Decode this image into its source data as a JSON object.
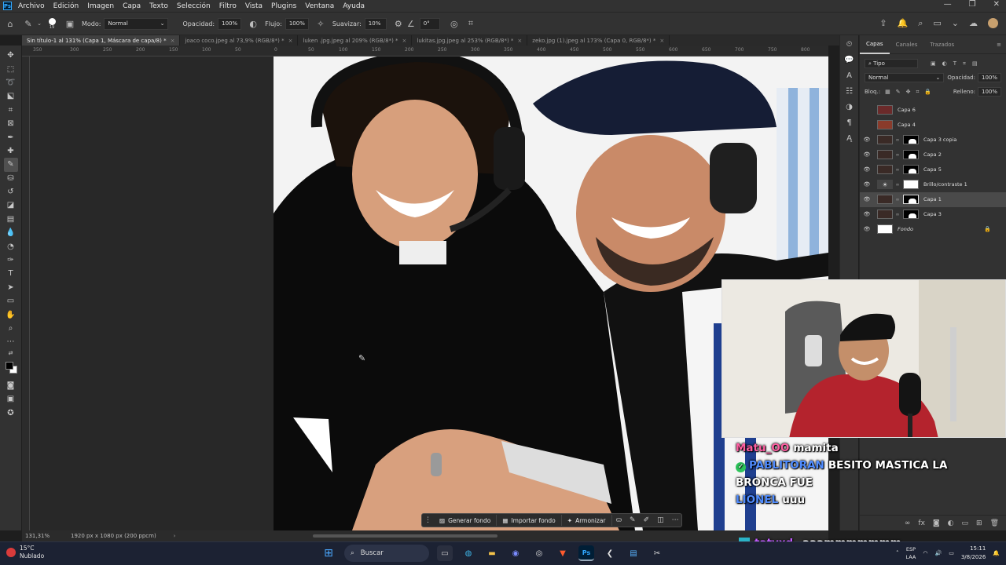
{
  "menu": {
    "items": [
      "Archivo",
      "Edición",
      "Imagen",
      "Capa",
      "Texto",
      "Selección",
      "Filtro",
      "Vista",
      "Plugins",
      "Ventana",
      "Ayuda"
    ],
    "logo": "Ps"
  },
  "options": {
    "brush_size": "19",
    "mode_label": "Modo:",
    "mode_value": "Normal",
    "opacity_label": "Opacidad:",
    "opacity_value": "100%",
    "flow_label": "Flujo:",
    "flow_value": "100%",
    "smooth_label": "Suavizar:",
    "smooth_value": "10%",
    "angle_value": "0°"
  },
  "tabs": [
    {
      "label": "Sin título-1 al 131% (Capa 1, Máscara de capa/8) *",
      "active": true
    },
    {
      "label": "joaco coco.jpeg al 73,9% (RGB/8*) *",
      "active": false
    },
    {
      "label": "luken .jpg.jpeg al 209% (RGB/8*) *",
      "active": false
    },
    {
      "label": "lukitas.jpg.jpeg al 253% (RGB/8*) *",
      "active": false
    },
    {
      "label": "zeko.jpg (1).jpeg al 173% (Capa 0, RGB/8*) *",
      "active": false
    }
  ],
  "ruler_ticks": [
    "350",
    "300",
    "250",
    "200",
    "150",
    "100",
    "50",
    "0",
    "50",
    "100",
    "150",
    "200",
    "250",
    "300",
    "350",
    "400",
    "450",
    "500",
    "550",
    "600",
    "650",
    "700",
    "750",
    "800",
    "850",
    "900",
    "950",
    "1000"
  ],
  "status": {
    "zoom": "131,31%",
    "doc_info": "1920 px x 1080 px (200 ppcm)"
  },
  "contextual_bar": {
    "generate_bg": "Generar fondo",
    "import_bg": "Importar fondo",
    "harmonize": "Armonizar"
  },
  "layers_panel": {
    "tabs": [
      "Capas",
      "Canales",
      "Trazados"
    ],
    "filter_label": "Tipo",
    "blend_mode": "Normal",
    "opacity_label": "Opacidad:",
    "opacity_value": "100%",
    "lock_label": "Bloq.:",
    "fill_label": "Relleno:",
    "fill_value": "100%",
    "layers": [
      {
        "name": "Capa 6",
        "visible": false,
        "mask": false,
        "selected": false,
        "italic": false
      },
      {
        "name": "Capa 4",
        "visible": false,
        "mask": false,
        "selected": false,
        "italic": false
      },
      {
        "name": "Capa 3 copia",
        "visible": true,
        "mask": true,
        "selected": false,
        "italic": false
      },
      {
        "name": "Capa 2",
        "visible": true,
        "mask": true,
        "selected": false,
        "italic": false
      },
      {
        "name": "Capa 5",
        "visible": true,
        "mask": true,
        "selected": false,
        "italic": false
      },
      {
        "name": "Brillo/contraste 1",
        "visible": true,
        "mask": true,
        "selected": false,
        "italic": false
      },
      {
        "name": "Capa 1",
        "visible": true,
        "mask": true,
        "selected": true,
        "italic": false
      },
      {
        "name": "Capa 3",
        "visible": true,
        "mask": true,
        "selected": false,
        "italic": false
      },
      {
        "name": "Fondo",
        "visible": true,
        "mask": false,
        "selected": false,
        "italic": true
      }
    ]
  },
  "chat": [
    {
      "user": "Matu_OO",
      "text": "mamita",
      "color": "#ff5fa2",
      "badge": false
    },
    {
      "user": "PABLITORAN",
      "text": "BESITO MASTICA LA BRONCA FUE",
      "color": "#4f8cff",
      "badge": true
    },
    {
      "user": "LIONEL",
      "text": "uuu",
      "color": "#4f8cff",
      "badge": false
    },
    {
      "user": "tatyxd_",
      "text": "aaammmmmmm",
      "color": "#c25bff",
      "badge": true
    }
  ],
  "taskbar": {
    "temperature": "15°C",
    "weather": "Nublado",
    "search": "Buscar",
    "lang_top": "ESP",
    "lang_bottom": "LAA",
    "time": "15:11",
    "date": "3/8/2026"
  }
}
